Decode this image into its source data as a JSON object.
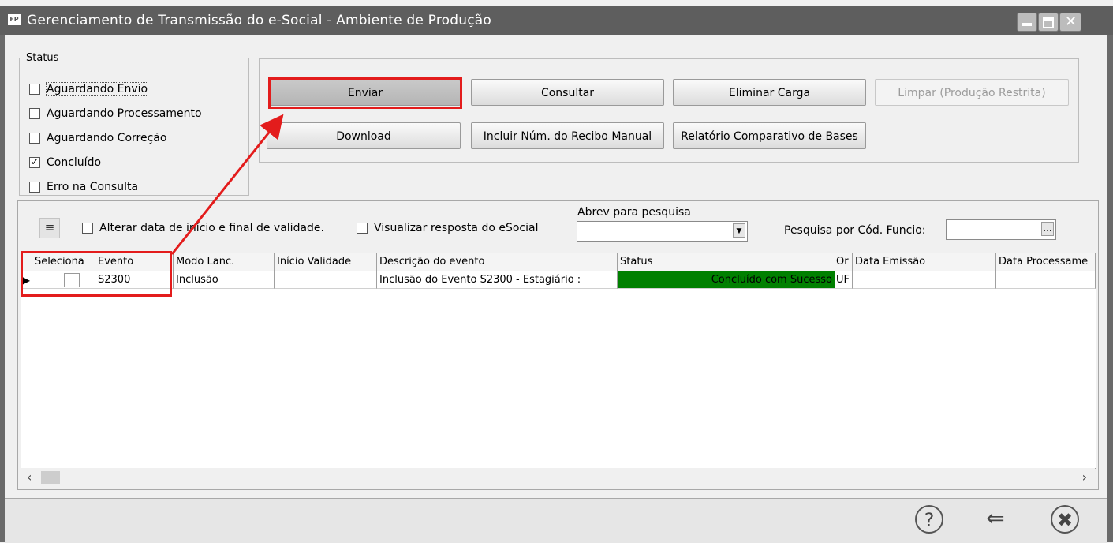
{
  "window": {
    "app_icon": "FP",
    "title": "Gerenciamento de Transmissão do e-Social - Ambiente de Produção"
  },
  "status_group": {
    "legend": "Status",
    "options": [
      {
        "label": "Aguardando Envio",
        "checked": false
      },
      {
        "label": "Aguardando Processamento",
        "checked": false
      },
      {
        "label": "Aguardando Correção",
        "checked": false
      },
      {
        "label": "Concluído",
        "checked": true
      },
      {
        "label": "Erro na Consulta",
        "checked": false
      }
    ]
  },
  "actions": {
    "enviar": "Enviar",
    "consultar": "Consultar",
    "eliminar_carga": "Eliminar Carga",
    "limpar": "Limpar (Produção Restrita)",
    "download": "Download",
    "incluir_recibo": "Incluir Núm. do Recibo Manual",
    "relatorio": "Relatório Comparativo de Bases"
  },
  "filters": {
    "alterar_data_label": "Alterar data de início e final de validade.",
    "visualizar_resposta_label": "Visualizar resposta do eSocial",
    "abrev_label": "Abrev para pesquisa",
    "abrev_value": "",
    "pesquisa_cod_label": "Pesquisa por Cód. Funcio:",
    "pesquisa_cod_value": "",
    "ellipsis": "..."
  },
  "grid": {
    "columns": [
      "Seleciona",
      "Evento",
      "Modo Lanc.",
      "Início Validade",
      "Descrição do evento",
      "Status",
      "Or",
      "Data Emissão",
      "Data Processame"
    ],
    "rows": [
      {
        "indicator": "▶",
        "seleciona": "",
        "evento": "S2300",
        "modo": "Inclusão",
        "inicio": "",
        "descricao": "Inclusão do Evento S2300 - Estagiário :",
        "status": "Concluído com Sucesso",
        "status_color": "#008000",
        "or": "UF",
        "emissao": "",
        "processamento": ""
      }
    ]
  },
  "footer": {
    "help_icon": "?",
    "back_icon": "⇐",
    "close_icon": "✖"
  },
  "colors": {
    "titlebar": "#5e5e5e",
    "highlight": "#e31c1c",
    "status_ok": "#008000"
  }
}
